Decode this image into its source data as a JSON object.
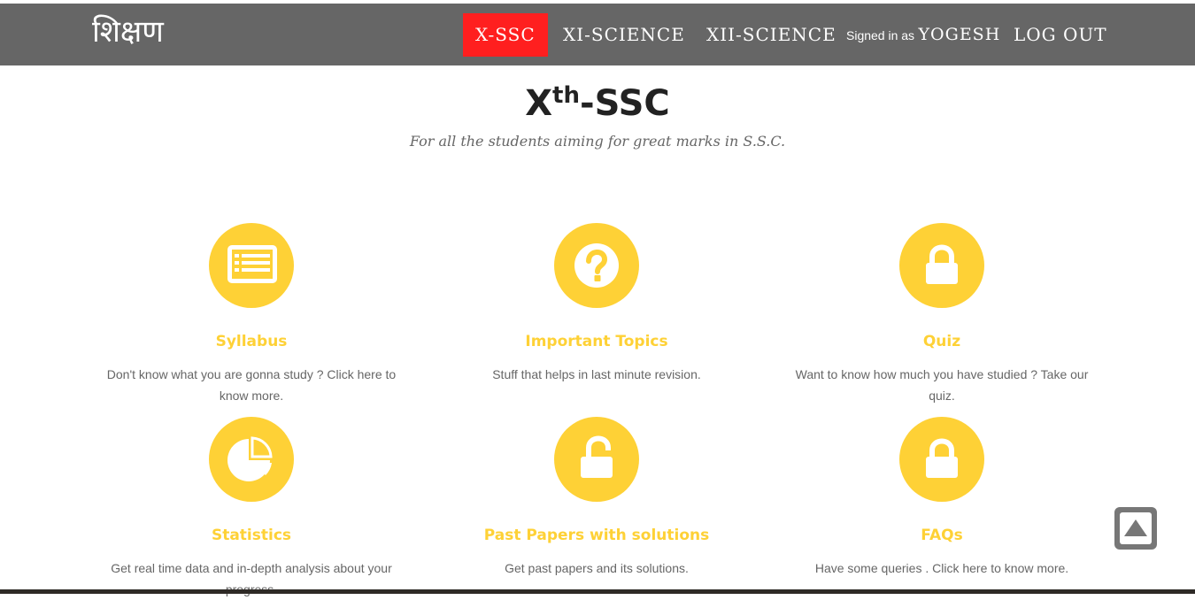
{
  "navbar": {
    "brand": "शिक्षण",
    "links": [
      "X-SSC",
      "XI-SCIENCE",
      "XII-SCIENCE"
    ],
    "signed_in_prefix": "Signed in as",
    "signed_in_user": "YOGESH",
    "logout": "LOG OUT",
    "active_color": "#ff1f1f",
    "bar_color": "#666666"
  },
  "header": {
    "title_main": "X",
    "title_sup": "th",
    "title_suffix": "-SSC",
    "subtitle": "For all the students aiming for great marks in S.S.C."
  },
  "accent_color": "#fed136",
  "features": [
    {
      "icon": "list-alt-icon",
      "title": "Syllabus",
      "description": "Don't know what you are gonna study ? Click here to know more."
    },
    {
      "icon": "question-circle-icon",
      "title": "Important Topics",
      "description": "Stuff that helps in last minute revision."
    },
    {
      "icon": "lock-icon",
      "title": "Quiz",
      "description": "Want to know how much you have studied ? Take our quiz."
    },
    {
      "icon": "pie-chart-icon",
      "title": "Statistics",
      "description": "Get real time data and in-depth analysis about your progress."
    },
    {
      "icon": "unlock-icon",
      "title": "Past Papers with solutions",
      "description": "Get past papers and its solutions."
    },
    {
      "icon": "lock-icon",
      "title": "FAQs",
      "description": "Have some queries . Click here to know more."
    }
  ],
  "scroll_top_icon": "arrow-up-icon"
}
